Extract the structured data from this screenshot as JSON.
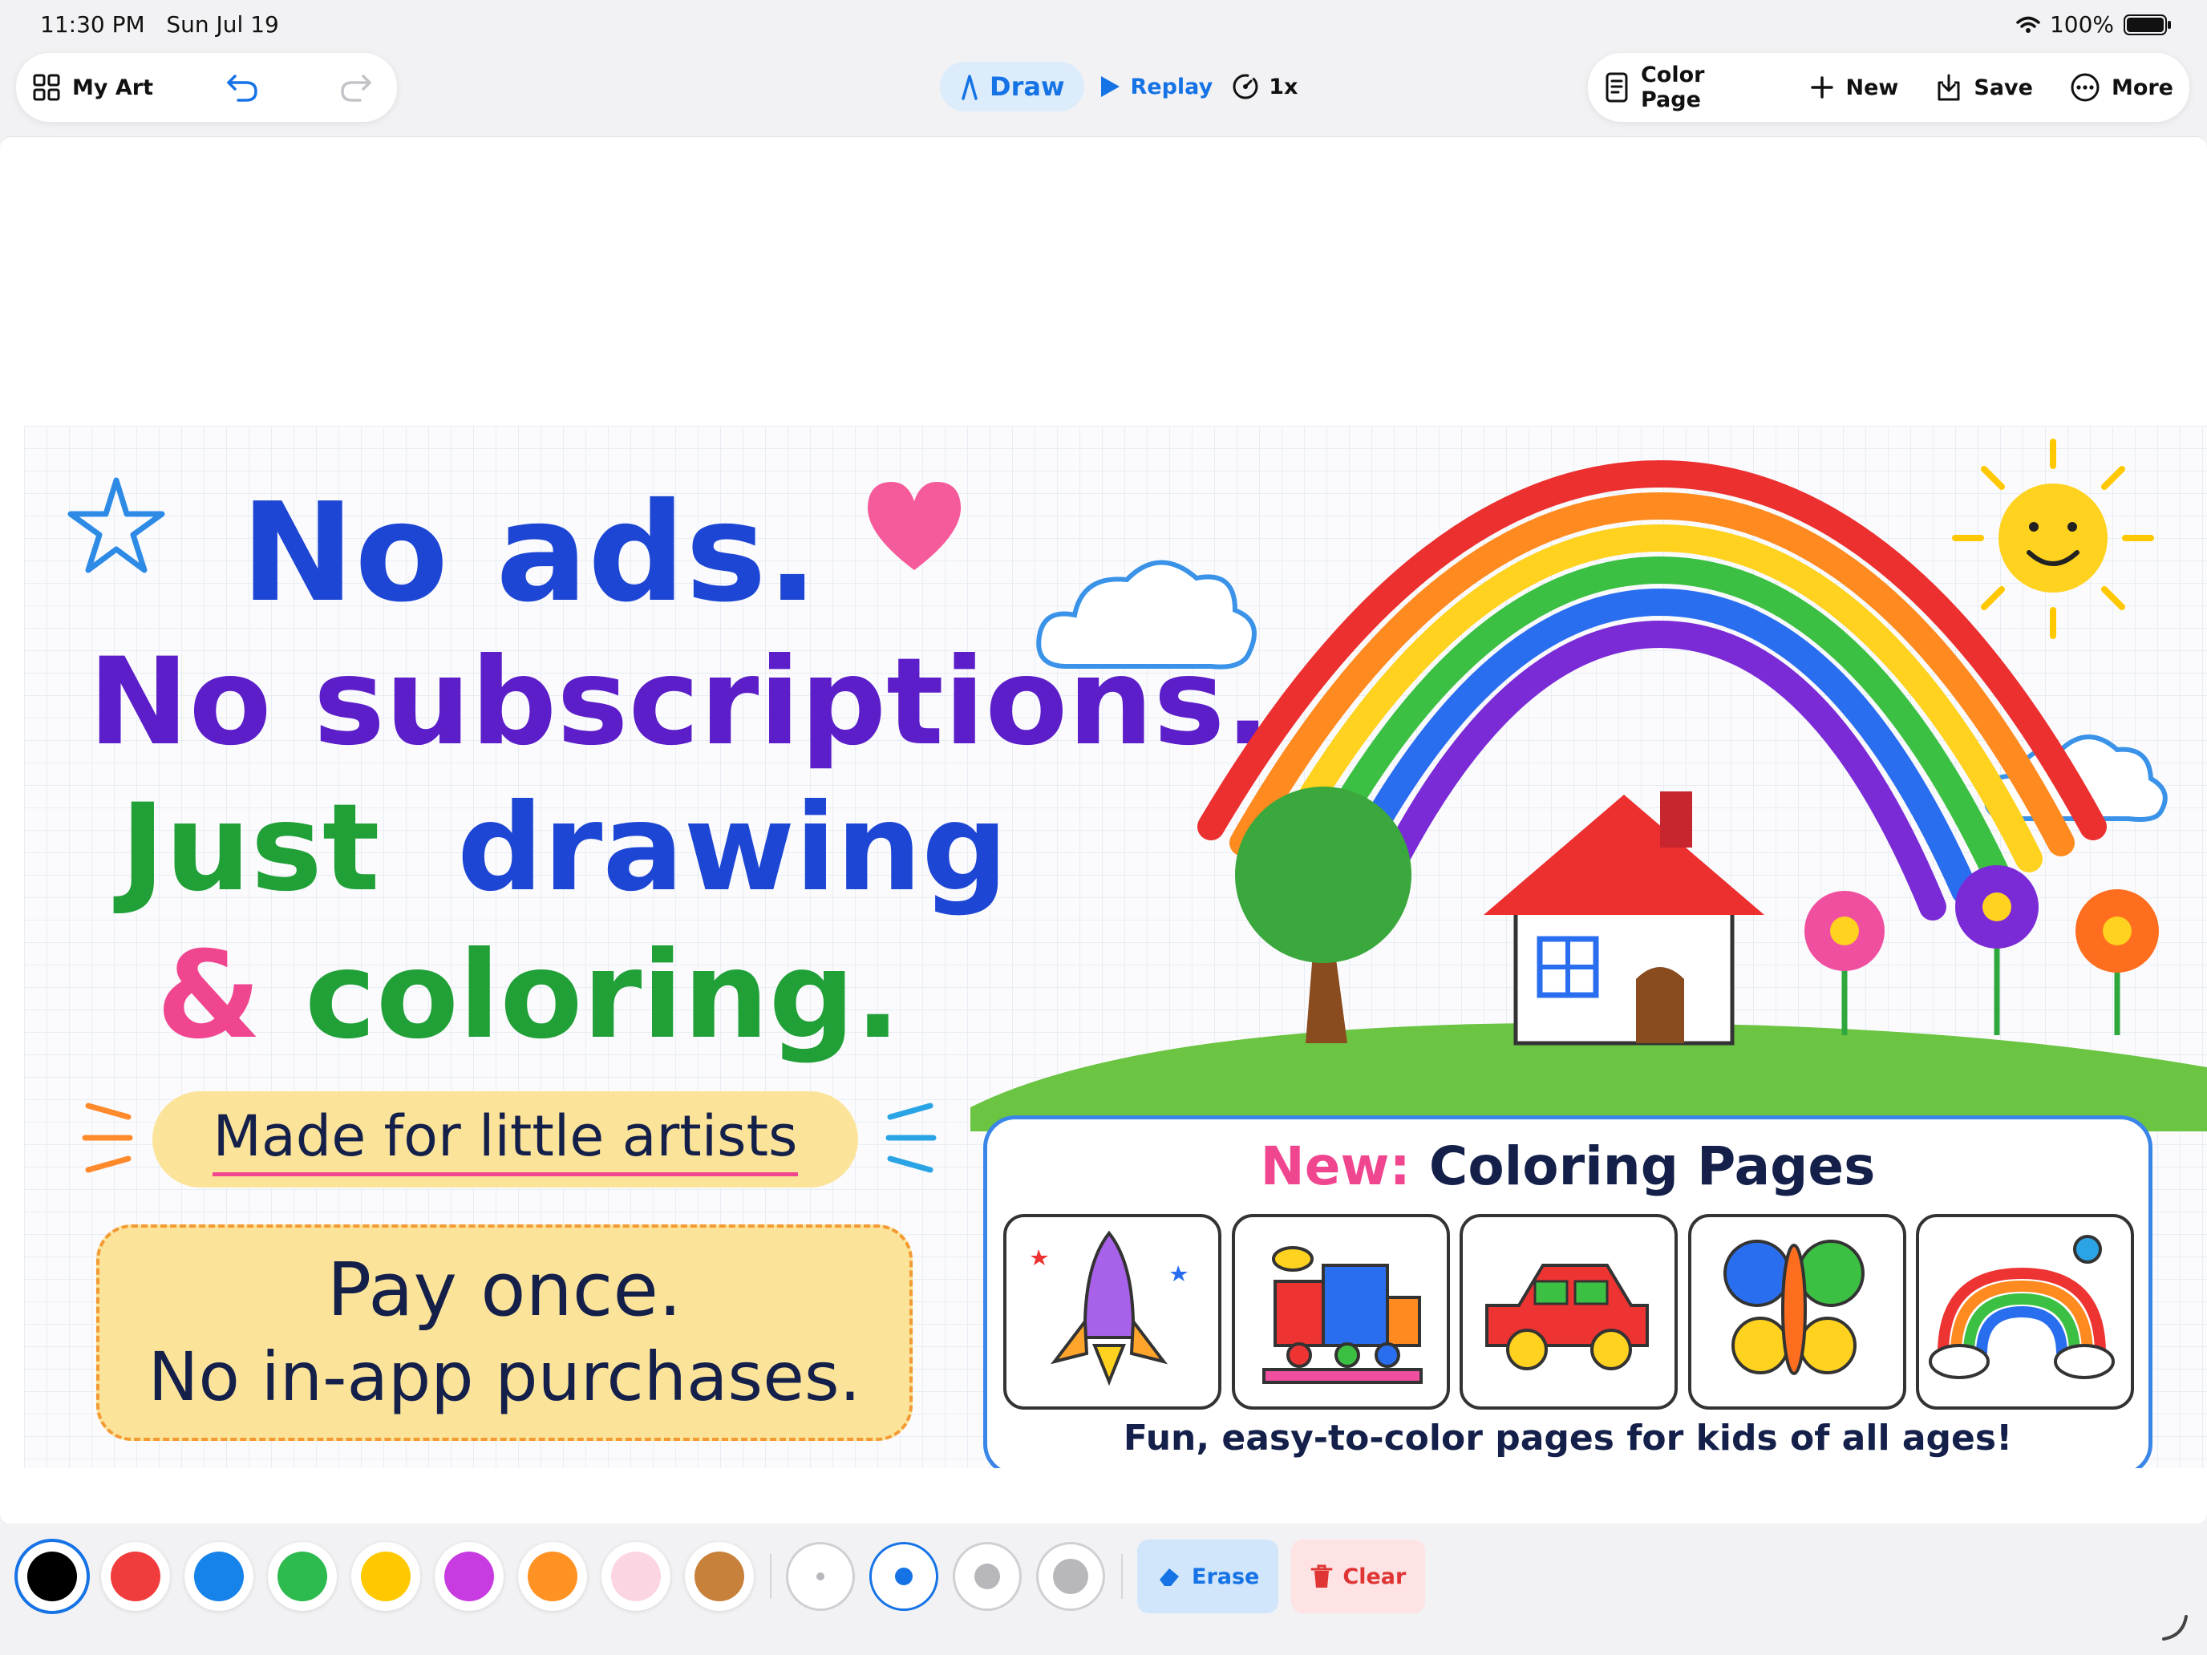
{
  "status_bar": {
    "time": "11:30 PM",
    "date": "Sun Jul 19",
    "battery": "100%",
    "icons": [
      "wifi-icon",
      "battery-icon"
    ]
  },
  "toolbar": {
    "my_art": "My Art",
    "draw": "Draw",
    "replay": "Replay",
    "speed": "1x",
    "color_page": "Color Page",
    "new": "New",
    "save": "Save",
    "more": "More"
  },
  "artwork": {
    "line1": "No ads.",
    "line2": "No subscriptions.",
    "line3a": "Just",
    "line3b": "drawing",
    "line4a": "&",
    "line4b": "coloring.",
    "made_for": "Made for little artists",
    "pay_line1": "Pay once.",
    "pay_line2": "No in-app purchases.",
    "coloring_new": "New:",
    "coloring_title": "Coloring Pages",
    "coloring_subtitle": "Fun, easy-to-color pages for kids of all ages!",
    "coloring_cards": [
      "rocket",
      "train",
      "car",
      "butterfly",
      "rainbow"
    ]
  },
  "palette": {
    "colors": [
      "#000000",
      "#f03c3c",
      "#1683ea",
      "#2dba4e",
      "#ffc800",
      "#c73be0",
      "#ff9222",
      "#fbd6e2",
      "#c8813a"
    ],
    "selected_index": 0
  },
  "brush_sizes": {
    "count": 4,
    "selected_index": 1
  },
  "actions": {
    "erase": "Erase",
    "clear": "Clear"
  },
  "colors": {
    "accent": "#1673e6",
    "danger": "#e03535"
  }
}
